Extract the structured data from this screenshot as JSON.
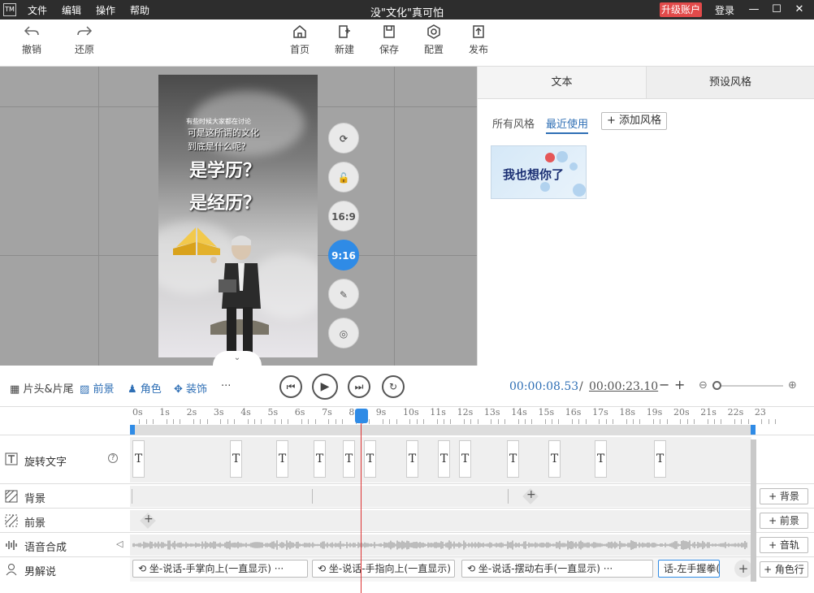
{
  "titlebar": {
    "logo": "TM",
    "menus": [
      "文件",
      "编辑",
      "操作",
      "帮助"
    ],
    "title": "没\"文化\"真可怕",
    "upgrade": "升级账户",
    "login": "登录",
    "minimize": "—",
    "maximize": "☐",
    "close": "✕"
  },
  "toolbar": {
    "undo": "撤销",
    "redo": "还原",
    "home": "首页",
    "new": "新建",
    "save": "保存",
    "config": "配置",
    "publish": "发布"
  },
  "canvas": {
    "tiny_text": "有些时候大家都在讨论",
    "line1": "可是这所谓的文化",
    "line2": "到底是什么呢？",
    "big1": "是学历？",
    "big2": "是经历？",
    "side_buttons": [
      {
        "icon": "refresh-icon",
        "label": "⟳"
      },
      {
        "icon": "unlock-icon",
        "label": "🔓"
      },
      {
        "icon": "ratio-16-9",
        "label": "16:9"
      },
      {
        "icon": "ratio-9-16",
        "label": "9:16"
      },
      {
        "icon": "pen-icon",
        "label": "✎"
      },
      {
        "icon": "target-icon",
        "label": "◎"
      }
    ],
    "collapse": "⌄"
  },
  "rightpanel": {
    "tabs": [
      "文本",
      "预设风格"
    ],
    "subtabs": [
      "所有风格",
      "最近使用"
    ],
    "add_style": "+ 添加风格",
    "thumb_text": "我也想你了"
  },
  "controls": {
    "intro_outro": "片头&片尾",
    "foreground": "前景",
    "character": "角色",
    "decoration": "装饰",
    "more": "···",
    "current_time": "00:00:08.53",
    "separator": "/",
    "total_time": "00:00:23.10",
    "zoom_minus": "−",
    "zoom_plus": "+"
  },
  "ruler": {
    "labels": [
      "0s",
      "1s",
      "2s",
      "3s",
      "4s",
      "5s",
      "6s",
      "7s",
      "8s",
      "9s",
      "10s",
      "11s",
      "12s",
      "13s",
      "14s",
      "15s",
      "16s",
      "17s",
      "18s",
      "19s",
      "20s",
      "21s",
      "22s",
      "23"
    ]
  },
  "tracks": {
    "rotate_text": {
      "label": "旋转文字",
      "help": "?",
      "blocks": [
        "T",
        "T",
        "T",
        "T",
        "T",
        "T",
        "T",
        "T",
        "T",
        "T",
        "T",
        "T",
        "T"
      ]
    },
    "background": {
      "label": "背景",
      "add": "+ 背景"
    },
    "foreground": {
      "label": "前景",
      "add": "+ 前景"
    },
    "tts": {
      "label": "语音合成",
      "add": "+ 音轨"
    },
    "narrator": {
      "label": "男解说",
      "add": "+ 角色行",
      "clips": [
        "坐-说话-手掌向上(一直显示)",
        "坐-说话-手指向上(一直显示)",
        "坐-说话-摆动右手(一直显示)",
        "话-左手握拳("
      ]
    }
  }
}
